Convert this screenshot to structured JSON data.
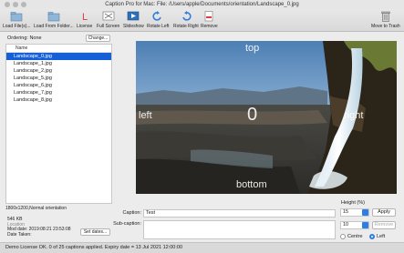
{
  "window": {
    "title": "Caption Pro for Mac: File: /Users/apple/Documents/orientation/Landscape_0.jpg"
  },
  "toolbar": {
    "load_files": "Load File(s)...",
    "load_folder": "Load From Folder...",
    "license": "License",
    "full_screen": "Full Screen",
    "slideshow": "Slideshow",
    "rotate_left": "Rotate Left",
    "rotate_right": "Rotate Right",
    "remove": "Remove",
    "move_to_trash": "Move to Trash"
  },
  "ordering": {
    "label": "Ordering: None",
    "change_label": "Change..."
  },
  "file_list": {
    "header": "Name",
    "items": [
      "Landscape_0.jpg",
      "Landscape_1.jpg",
      "Landscape_2.jpg",
      "Landscape_5.jpg",
      "Landscape_6.jpg",
      "Landscape_7.jpg",
      "Landscape_8.jpg"
    ],
    "selected_index": 0
  },
  "info": {
    "resolution": "1800x1200,Normal orientation",
    "size": "546 KB",
    "location_label": "Location",
    "mod_date": "Mod date: 2019:08:21 23:53:08",
    "date_taken": "Date Taken:",
    "set_dates": "Set dates..."
  },
  "image_overlay": {
    "top": "top",
    "left": "left",
    "right": "right",
    "center": "0",
    "bottom": "bottom"
  },
  "caption": {
    "caption_label": "Caption:",
    "caption_value": "Test",
    "subcaption_label": "Sub-caption:",
    "height_label": "Height (%)",
    "caption_height": "15",
    "subcaption_height": "10",
    "apply": "Apply",
    "remove": "Remove",
    "align_centre": "Centre",
    "align_left": "Left",
    "selected_align": "Left"
  },
  "status": {
    "text": "Demo License OK. 0 of 25 captions applied.  Expiry date = 13 Jul 2021 12:00:00"
  },
  "colors": {
    "selection": "#1560d6",
    "accent": "#2f7de1",
    "red": "#e23b3b"
  }
}
